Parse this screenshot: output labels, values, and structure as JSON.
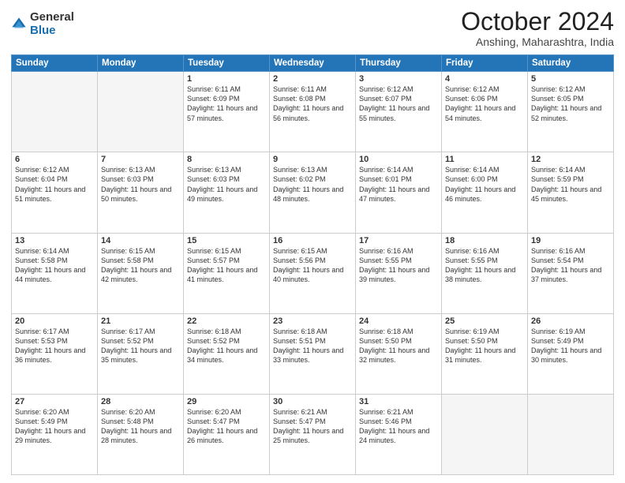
{
  "logo": {
    "general": "General",
    "blue": "Blue"
  },
  "header": {
    "month": "October 2024",
    "location": "Anshing, Maharashtra, India"
  },
  "weekdays": [
    "Sunday",
    "Monday",
    "Tuesday",
    "Wednesday",
    "Thursday",
    "Friday",
    "Saturday"
  ],
  "weeks": [
    [
      {
        "day": "",
        "empty": true
      },
      {
        "day": "",
        "empty": true
      },
      {
        "day": "1",
        "sunrise": "6:11 AM",
        "sunset": "6:09 PM",
        "daylight": "11 hours and 57 minutes."
      },
      {
        "day": "2",
        "sunrise": "6:11 AM",
        "sunset": "6:08 PM",
        "daylight": "11 hours and 56 minutes."
      },
      {
        "day": "3",
        "sunrise": "6:12 AM",
        "sunset": "6:07 PM",
        "daylight": "11 hours and 55 minutes."
      },
      {
        "day": "4",
        "sunrise": "6:12 AM",
        "sunset": "6:06 PM",
        "daylight": "11 hours and 54 minutes."
      },
      {
        "day": "5",
        "sunrise": "6:12 AM",
        "sunset": "6:05 PM",
        "daylight": "11 hours and 52 minutes."
      }
    ],
    [
      {
        "day": "6",
        "sunrise": "6:12 AM",
        "sunset": "6:04 PM",
        "daylight": "11 hours and 51 minutes."
      },
      {
        "day": "7",
        "sunrise": "6:13 AM",
        "sunset": "6:03 PM",
        "daylight": "11 hours and 50 minutes."
      },
      {
        "day": "8",
        "sunrise": "6:13 AM",
        "sunset": "6:03 PM",
        "daylight": "11 hours and 49 minutes."
      },
      {
        "day": "9",
        "sunrise": "6:13 AM",
        "sunset": "6:02 PM",
        "daylight": "11 hours and 48 minutes."
      },
      {
        "day": "10",
        "sunrise": "6:14 AM",
        "sunset": "6:01 PM",
        "daylight": "11 hours and 47 minutes."
      },
      {
        "day": "11",
        "sunrise": "6:14 AM",
        "sunset": "6:00 PM",
        "daylight": "11 hours and 46 minutes."
      },
      {
        "day": "12",
        "sunrise": "6:14 AM",
        "sunset": "5:59 PM",
        "daylight": "11 hours and 45 minutes."
      }
    ],
    [
      {
        "day": "13",
        "sunrise": "6:14 AM",
        "sunset": "5:58 PM",
        "daylight": "11 hours and 44 minutes."
      },
      {
        "day": "14",
        "sunrise": "6:15 AM",
        "sunset": "5:58 PM",
        "daylight": "11 hours and 42 minutes."
      },
      {
        "day": "15",
        "sunrise": "6:15 AM",
        "sunset": "5:57 PM",
        "daylight": "11 hours and 41 minutes."
      },
      {
        "day": "16",
        "sunrise": "6:15 AM",
        "sunset": "5:56 PM",
        "daylight": "11 hours and 40 minutes."
      },
      {
        "day": "17",
        "sunrise": "6:16 AM",
        "sunset": "5:55 PM",
        "daylight": "11 hours and 39 minutes."
      },
      {
        "day": "18",
        "sunrise": "6:16 AM",
        "sunset": "5:55 PM",
        "daylight": "11 hours and 38 minutes."
      },
      {
        "day": "19",
        "sunrise": "6:16 AM",
        "sunset": "5:54 PM",
        "daylight": "11 hours and 37 minutes."
      }
    ],
    [
      {
        "day": "20",
        "sunrise": "6:17 AM",
        "sunset": "5:53 PM",
        "daylight": "11 hours and 36 minutes."
      },
      {
        "day": "21",
        "sunrise": "6:17 AM",
        "sunset": "5:52 PM",
        "daylight": "11 hours and 35 minutes."
      },
      {
        "day": "22",
        "sunrise": "6:18 AM",
        "sunset": "5:52 PM",
        "daylight": "11 hours and 34 minutes."
      },
      {
        "day": "23",
        "sunrise": "6:18 AM",
        "sunset": "5:51 PM",
        "daylight": "11 hours and 33 minutes."
      },
      {
        "day": "24",
        "sunrise": "6:18 AM",
        "sunset": "5:50 PM",
        "daylight": "11 hours and 32 minutes."
      },
      {
        "day": "25",
        "sunrise": "6:19 AM",
        "sunset": "5:50 PM",
        "daylight": "11 hours and 31 minutes."
      },
      {
        "day": "26",
        "sunrise": "6:19 AM",
        "sunset": "5:49 PM",
        "daylight": "11 hours and 30 minutes."
      }
    ],
    [
      {
        "day": "27",
        "sunrise": "6:20 AM",
        "sunset": "5:49 PM",
        "daylight": "11 hours and 29 minutes."
      },
      {
        "day": "28",
        "sunrise": "6:20 AM",
        "sunset": "5:48 PM",
        "daylight": "11 hours and 28 minutes."
      },
      {
        "day": "29",
        "sunrise": "6:20 AM",
        "sunset": "5:47 PM",
        "daylight": "11 hours and 26 minutes."
      },
      {
        "day": "30",
        "sunrise": "6:21 AM",
        "sunset": "5:47 PM",
        "daylight": "11 hours and 25 minutes."
      },
      {
        "day": "31",
        "sunrise": "6:21 AM",
        "sunset": "5:46 PM",
        "daylight": "11 hours and 24 minutes."
      },
      {
        "day": "",
        "empty": true
      },
      {
        "day": "",
        "empty": true
      }
    ]
  ]
}
